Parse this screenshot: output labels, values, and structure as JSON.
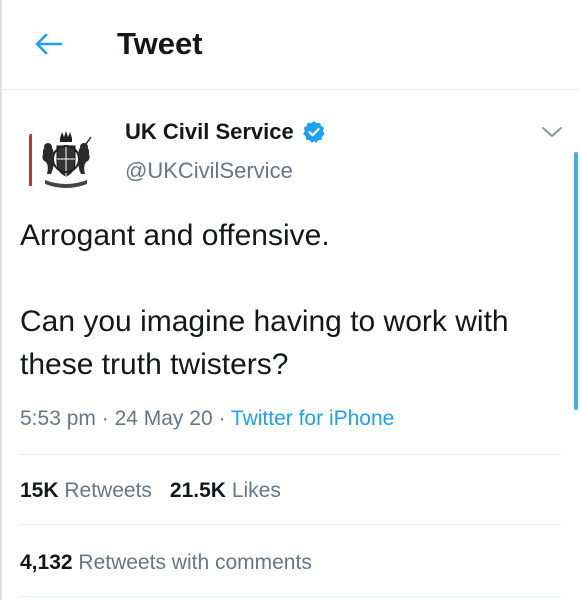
{
  "header": {
    "back_icon": "arrow-left-icon",
    "title": "Tweet"
  },
  "tweet": {
    "author": {
      "name": "UK Civil Service",
      "handle": "@UKCivilService",
      "verified": true,
      "avatar_icon": "royal-coat-of-arms-icon"
    },
    "text": "Arrogant and offensive.\n\nCan you imagine having to work with these truth twisters?",
    "time": "5:53 pm",
    "date": "24 May 20",
    "source": "Twitter for iPhone",
    "separator": " · ",
    "retweets_count": "15K",
    "retweets_label": "Retweets",
    "likes_count": "21.5K",
    "likes_label": "Likes",
    "comments_count": "4,132",
    "comments_label": "Retweets with comments"
  },
  "colors": {
    "accent": "#1da1f2",
    "text_primary": "#14171a",
    "text_secondary": "#657786",
    "divider": "#e6ecf0",
    "crest_red": "#c0392b"
  }
}
